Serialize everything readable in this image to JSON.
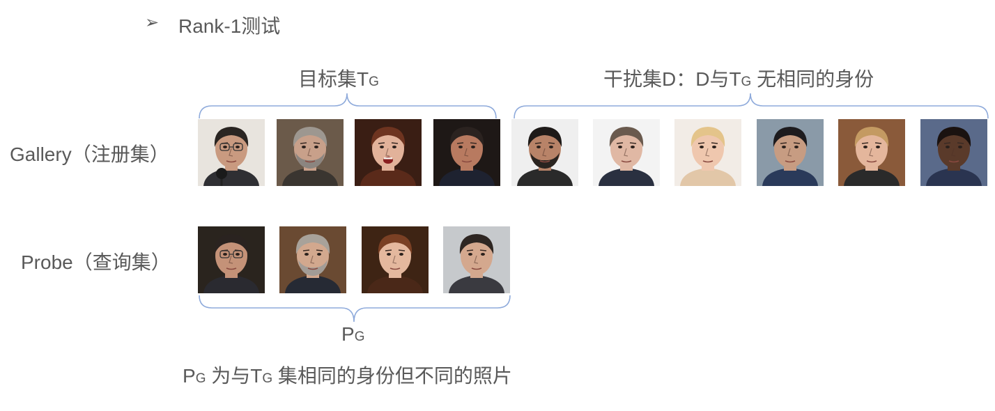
{
  "heading": {
    "bullet": "➢",
    "text": "Rank-1测试"
  },
  "target_set": {
    "prefix": "目标集T",
    "sub": "G"
  },
  "distractor_set": {
    "prefix": "干扰集D：D与T",
    "sub": "G",
    "suffix": " 无相同的身份"
  },
  "rows": {
    "gallery": "Gallery（注册集）",
    "probe": "Probe（查询集）"
  },
  "probe_set": {
    "prefix": "P",
    "sub": "G"
  },
  "note": {
    "p": "P",
    "p_sub": "G",
    "mid": " 为与T",
    "t_sub": "G",
    "rest": " 集相同的身份但不同的照片"
  },
  "colors": {
    "text": "#595959",
    "brace": "#8eaadb"
  },
  "gallery_faces": [
    {
      "name": "gallery-face-1",
      "bg": "#e8e4de",
      "skin": "#c99a80",
      "hair": "#2a2522",
      "shirt": "#2f2f33",
      "glasses": true,
      "mic": true
    },
    {
      "name": "gallery-face-2",
      "bg": "#6b5a4a",
      "skin": "#c8a08a",
      "hair": "#9d9790",
      "shirt": "#3a3530",
      "glasses": false,
      "beard": "#8b8580"
    },
    {
      "name": "gallery-face-3",
      "bg": "#3a1e14",
      "skin": "#e2b29a",
      "hair": "#6e3420",
      "shirt": "#5a2a1a",
      "glasses": false,
      "mouth": true
    },
    {
      "name": "gallery-face-4",
      "bg": "#1e1816",
      "skin": "#b87a60",
      "hair": "#2b2320",
      "shirt": "#1e2230",
      "glasses": false
    },
    {
      "name": "gallery-face-5",
      "bg": "#efefef",
      "skin": "#b88368",
      "hair": "#1e1a18",
      "shirt": "#2a2a2a",
      "glasses": false,
      "beard": "#2a2420"
    },
    {
      "name": "gallery-face-6",
      "bg": "#f3f3f3",
      "skin": "#e0b8a4",
      "hair": "#6a5a4e",
      "shirt": "#2a3040",
      "glasses": false
    },
    {
      "name": "gallery-face-7",
      "bg": "#f2ece6",
      "skin": "#efc7ae",
      "hair": "#e4c48a",
      "shirt": "#e2c7a8",
      "glasses": false
    },
    {
      "name": "gallery-face-8",
      "bg": "#8a9aa8",
      "skin": "#c79c82",
      "hair": "#1d1b1e",
      "shirt": "#2a3a5a",
      "glasses": false
    },
    {
      "name": "gallery-face-9",
      "bg": "#8a5a3a",
      "skin": "#e4b69c",
      "hair": "#c49a62",
      "shirt": "#2a2a2a",
      "glasses": false
    },
    {
      "name": "gallery-face-10",
      "bg": "#5a6a8a",
      "skin": "#5a3a2a",
      "hair": "#1a1210",
      "shirt": "#2a3450",
      "glasses": false
    }
  ],
  "probe_faces": [
    {
      "name": "probe-face-1",
      "bg": "#2a241e",
      "skin": "#c49278",
      "hair": "#2a2320",
      "shirt": "#2a2a30",
      "glasses": true
    },
    {
      "name": "probe-face-2",
      "bg": "#6a4a32",
      "skin": "#d2a88e",
      "hair": "#a8a29a",
      "shirt": "#262a34",
      "glasses": false,
      "beard": "#a29c96"
    },
    {
      "name": "probe-face-3",
      "bg": "#3e2414",
      "skin": "#e4b89e",
      "hair": "#7a4024",
      "shirt": "#4a2818",
      "glasses": false
    },
    {
      "name": "probe-face-4",
      "bg": "#c6c9cc",
      "skin": "#d4a88e",
      "hair": "#2e2622",
      "shirt": "#3a3a40",
      "glasses": false
    }
  ]
}
